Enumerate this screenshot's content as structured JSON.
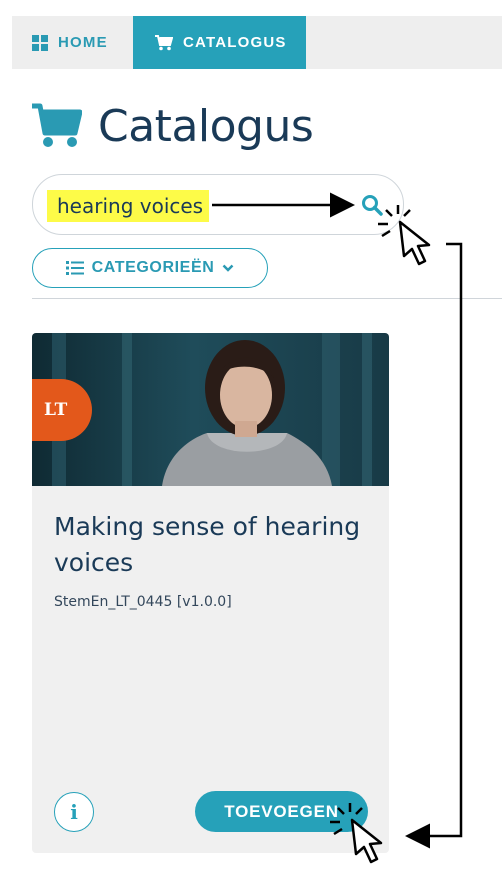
{
  "nav": {
    "home_label": "HOME",
    "catalogus_label": "CATALOGUS",
    "active_tab": "catalogus",
    "accent": "#26a1b9"
  },
  "page": {
    "title": "Catalogus"
  },
  "search": {
    "value": "hearing voices",
    "highlight_color": "#fdfb48",
    "button_icon": "search-icon"
  },
  "filters": {
    "categories_label": "CATEGORIEËN"
  },
  "card": {
    "badge": "LT",
    "badge_color": "#e3581b",
    "title": "Making sense of hearing voices",
    "code": "StemEn_LT_0445 [v1.0.0]",
    "info_label": "i",
    "add_label": "TOEVOEGEN"
  },
  "annotations": {
    "icons": [
      "arrow-icon",
      "click-cursor-icon"
    ]
  }
}
